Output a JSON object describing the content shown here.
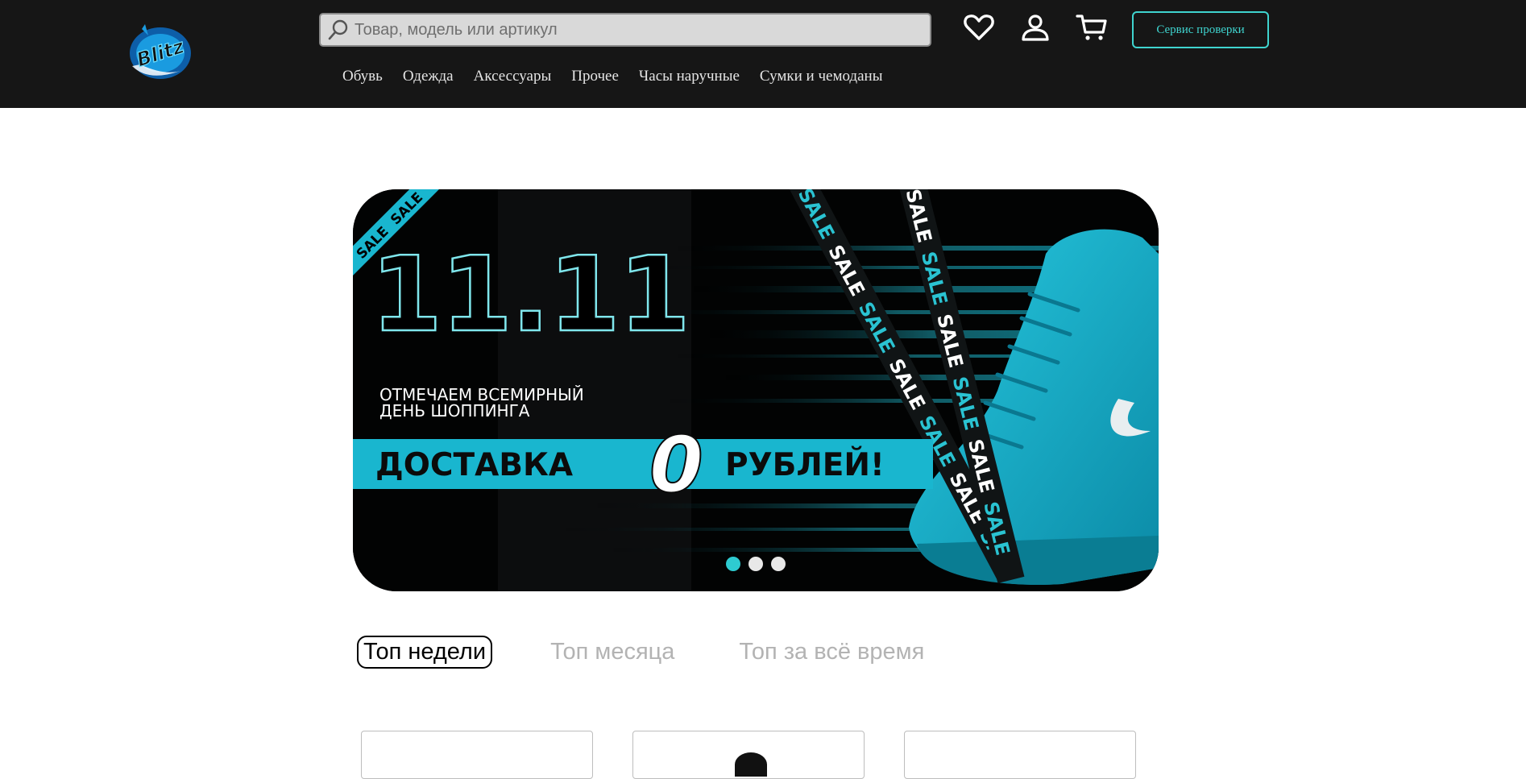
{
  "brand": {
    "logo_text": "Blitz"
  },
  "search": {
    "placeholder": "Товар, модель или артикул"
  },
  "header": {
    "service_button": "Сервис проверки",
    "icons": [
      "heart-icon",
      "user-icon",
      "cart-icon"
    ]
  },
  "nav": {
    "items": [
      "Обувь",
      "Одежда",
      "Аксессуары",
      "Прочее",
      "Часы наручные",
      "Сумки и чемоданы"
    ]
  },
  "banner": {
    "date": "11.11",
    "line1": "ОТМЕЧАЕМ ВСЕМИРНЫЙ",
    "line2": "ДЕНЬ ШОППИНГА",
    "delivery_left": "ДОСТАВКА",
    "delivery_zero": "0",
    "delivery_right": "РУБЛЕЙ!",
    "ribbon_word": "SALE",
    "slides_total": 3,
    "active_slide": 1
  },
  "tabs": [
    "Топ недели",
    "Топ месяца",
    "Топ за всё время"
  ],
  "colors": {
    "header_bg": "#161616",
    "accent": "#3fd4cf",
    "banner_cyan": "#19b6cf"
  }
}
